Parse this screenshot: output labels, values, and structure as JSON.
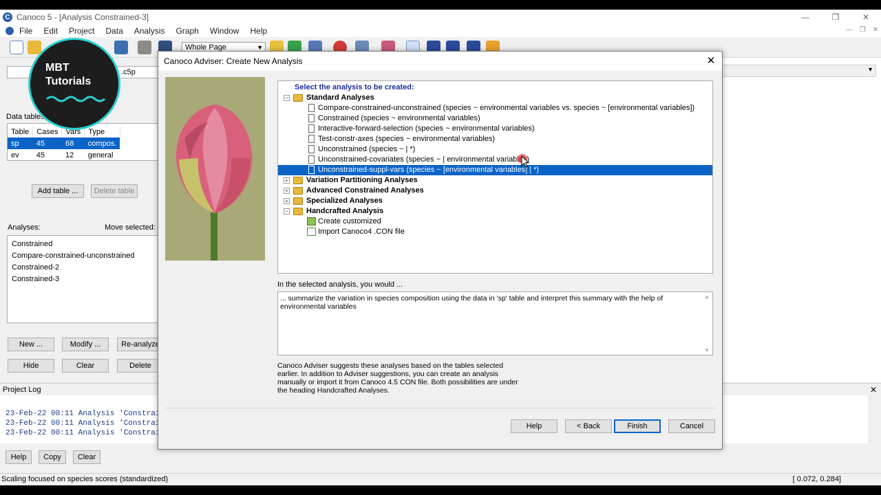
{
  "window": {
    "title": "Canoco 5 - [Analysis Constrained-3]",
    "app_icon": "C"
  },
  "menu": [
    "File",
    "Edit",
    "Project",
    "Data",
    "Analysis",
    "Graph",
    "Window",
    "Help"
  ],
  "toolbar": {
    "zoom_value": "Whole Page"
  },
  "left": {
    "file_name": ".c5p",
    "data_tables_label": "Data tables:",
    "table_headers": [
      "Table",
      "Cases",
      "Vars",
      "Type"
    ],
    "table_rows": [
      {
        "table": "sp",
        "cases": "45",
        "vars": "68",
        "type": "compos."
      },
      {
        "table": "ev",
        "cases": "45",
        "vars": "12",
        "type": "general"
      }
    ],
    "add_table": "Add table ...",
    "delete_table": "Delete table",
    "analyses_label": "Analyses:",
    "move_selected_label": "Move selected:",
    "analyses": [
      "Constrained",
      "Compare-constrained-unconstrained",
      "Constrained-2",
      "Constrained-3"
    ],
    "new_btn": "New ...",
    "modify_btn": "Modify ...",
    "reanalyze_btn": "Re-analyze",
    "hide_btn": "Hide",
    "clear_btn": "Clear",
    "delete_btn": "Delete"
  },
  "log": {
    "title": "Project Log",
    "lines": [
      "23-Feb-22 00:11 Analysis 'Constrai",
      "23-Feb-22 00:11 Analysis 'Constrai",
      "23-Feb-22 00:11 Analysis 'Constrai"
    ],
    "help_btn": "Help",
    "copy_btn": "Copy",
    "clear_btn": "Clear"
  },
  "status": {
    "left": "Scaling focused on species scores (standardized)",
    "right": "[ 0.072, 0.284]"
  },
  "logo": {
    "line1": "MBT",
    "line2": "Tutorials"
  },
  "dialog": {
    "title": "Canoco Adviser: Create New Analysis",
    "tree_heading": "Select the analysis to be created:",
    "standard": {
      "label": "Standard Analyses",
      "items": [
        "Compare-constrained-unconstrained (species ~ environmental variables vs. species ~ [environmental variables])",
        "Constrained (species ~ environmental variables)",
        "Interactive-forward-selection (species ~ environmental variables)",
        "Test-constr-axes (species ~ environmental variables)",
        "Unconstrained (species ~ | *)",
        "Unconstrained-covariates (species ~ | environmental variables)",
        "Unconstrained-suppl-vars (species ~ [environmental variables] | *)"
      ]
    },
    "groups": [
      "Variation Partitioning Analyses",
      "Advanced Constrained Analyses",
      "Specialized Analyses"
    ],
    "handcrafted": {
      "label": "Handcrafted Analysis",
      "items": [
        "Create customized",
        "Import Canoco4 .CON file"
      ]
    },
    "desc_label": "In the selected analysis, you would ...",
    "desc_text": "... summarize the variation in species composition using the data in 'sp' table and interpret this summary with the help of environmental variables",
    "note": "Canoco Adviser suggests these analyses based on the tables selected earlier. In addition to Adviser suggestions, you can create an analysis manually or import it from Canoco 4.5 CON file. Both possibilities are under the heading Handcrafted Analyses.",
    "buttons": {
      "help": "Help",
      "back": "< Back",
      "finish": "Finish",
      "cancel": "Cancel"
    }
  },
  "colors": {
    "selection": "#0a64c8",
    "heading": "#1a2fa0",
    "logo_ring": "#2ad0d0"
  }
}
